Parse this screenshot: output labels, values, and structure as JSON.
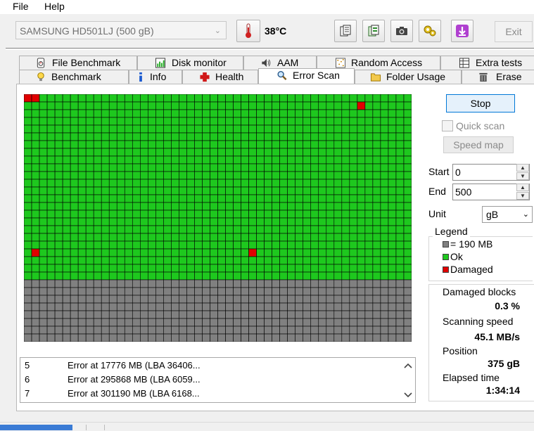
{
  "menu": {
    "file": "File",
    "help": "Help"
  },
  "toolbar": {
    "drive": "SAMSUNG HD501LJ (500 gB)",
    "temperature": "38°C",
    "exit_label": "Exit"
  },
  "tabs_top": [
    {
      "label": "File Benchmark",
      "icon": "stopwatch-icon"
    },
    {
      "label": "Disk monitor",
      "icon": "chart-icon"
    },
    {
      "label": "AAM",
      "icon": "speaker-icon"
    },
    {
      "label": "Random Access",
      "icon": "dots-grid-icon"
    },
    {
      "label": "Extra tests",
      "icon": "table-icon"
    }
  ],
  "tabs_bottom": [
    {
      "label": "Benchmark",
      "icon": "lightbulb-icon"
    },
    {
      "label": "Info",
      "icon": "info-icon"
    },
    {
      "label": "Health",
      "icon": "red-cross-icon"
    },
    {
      "label": "Error Scan",
      "icon": "magnifier-icon",
      "active": true
    },
    {
      "label": "Folder Usage",
      "icon": "folder-icon"
    },
    {
      "label": "Erase",
      "icon": "trash-icon"
    }
  ],
  "scan": {
    "columns": 50,
    "rows": 32,
    "scanned_fraction": 0.75,
    "damaged_cells": [
      [
        0,
        0
      ],
      [
        1,
        0
      ],
      [
        43,
        1
      ],
      [
        1,
        20
      ],
      [
        29,
        20
      ]
    ],
    "colors": {
      "ok": "#1ec81e",
      "damaged": "#e00000",
      "unscanned": "#808080",
      "gridline": "#000000"
    }
  },
  "errors": [
    {
      "n": "5",
      "text": "Error at 17776 MB (LBA 36406..."
    },
    {
      "n": "6",
      "text": "Error at 295868 MB (LBA 6059..."
    },
    {
      "n": "7",
      "text": "Error at 301190 MB (LBA 6168..."
    }
  ],
  "controls": {
    "stop_label": "Stop",
    "quick_scan_label": "Quick scan",
    "speed_map_label": "Speed map",
    "start_label": "Start",
    "start_value": "0",
    "end_label": "End",
    "end_value": "500",
    "unit_label": "Unit",
    "unit_value": "gB"
  },
  "legend": {
    "title": "Legend",
    "block": "= 190 MB",
    "ok": "Ok",
    "damaged": "Damaged"
  },
  "stats": {
    "damaged_label": "Damaged blocks",
    "damaged_value": "0.3 %",
    "speed_label": "Scanning speed",
    "speed_value": "45.1 MB/s",
    "position_label": "Position",
    "position_value": "375 gB",
    "elapsed_label": "Elapsed time",
    "elapsed_value": "1:34:14"
  }
}
